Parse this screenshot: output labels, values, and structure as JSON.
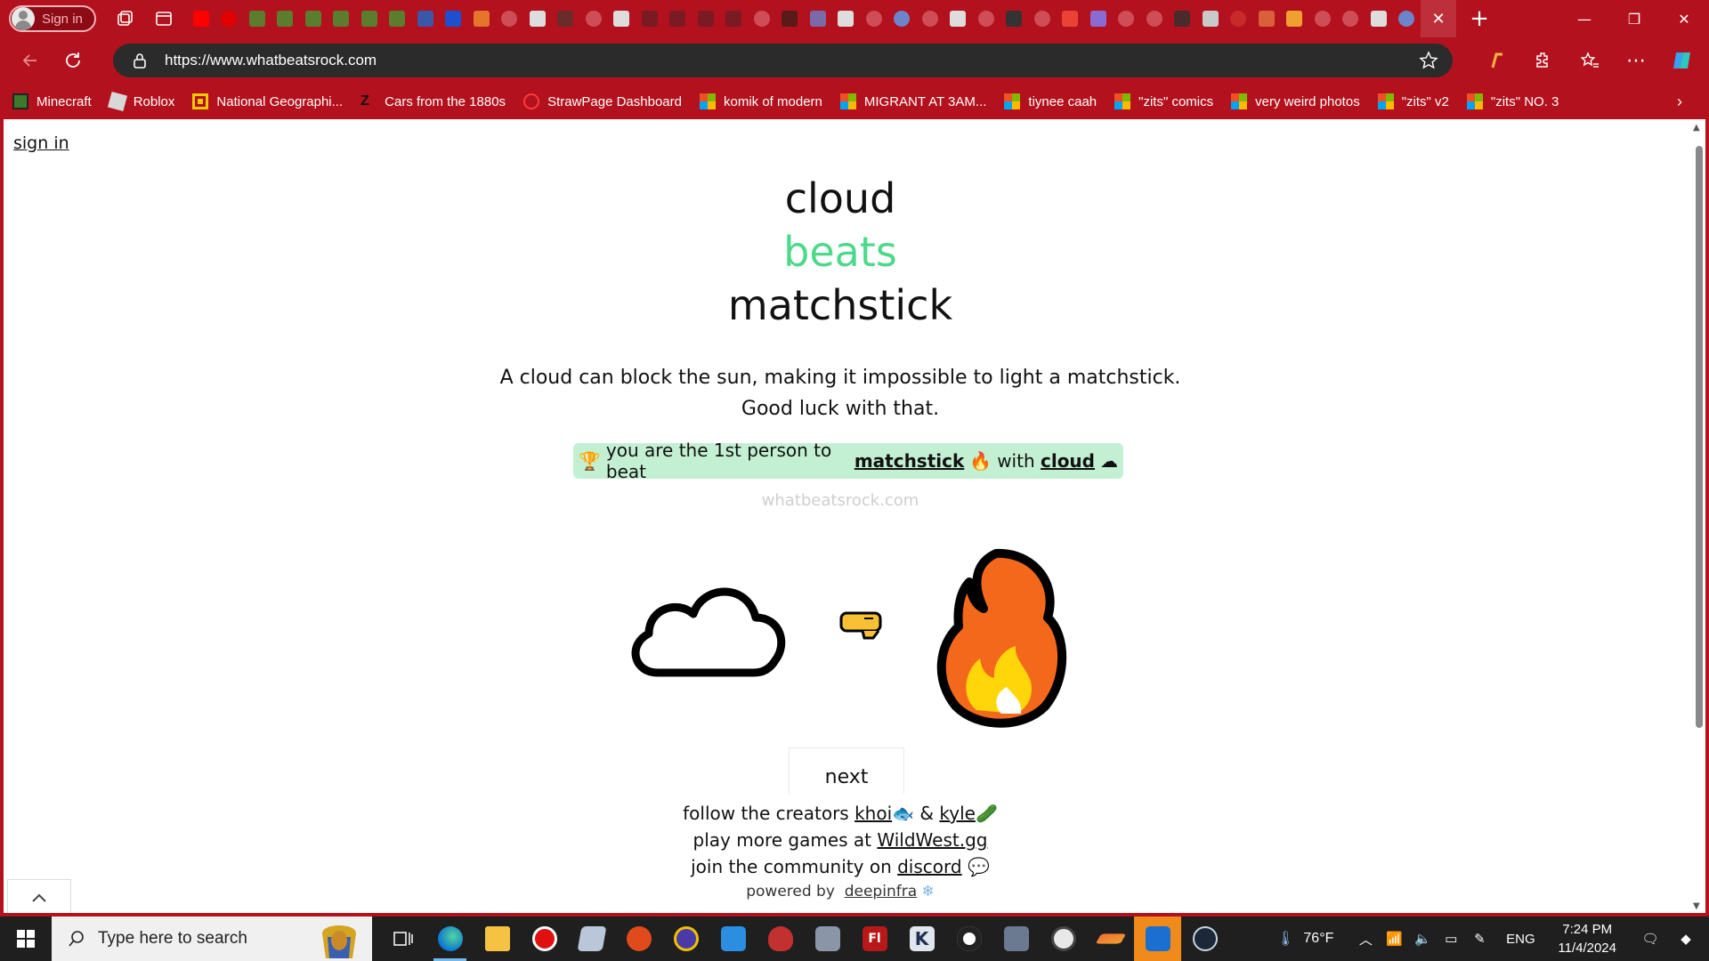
{
  "browser": {
    "profile_label": "Sign in",
    "url": "https://www.whatbeatsrock.com",
    "bookmarks": [
      {
        "label": "Minecraft",
        "icon": "minecraft-icon"
      },
      {
        "label": "Roblox",
        "icon": "roblox-icon"
      },
      {
        "label": "National Geographi...",
        "icon": "natgeo-icon"
      },
      {
        "label": "Cars from the 1880s",
        "icon": "z-icon"
      },
      {
        "label": "StrawPage Dashboard",
        "icon": "strawpage-icon"
      },
      {
        "label": "komik of modern",
        "icon": "ms-logo-icon"
      },
      {
        "label": "MIGRANT AT 3AM...",
        "icon": "ms-logo-icon"
      },
      {
        "label": "tiynee caah",
        "icon": "ms-logo-icon"
      },
      {
        "label": "\"zits\" comics",
        "icon": "ms-logo-icon"
      },
      {
        "label": "very weird photos",
        "icon": "ms-logo-icon"
      },
      {
        "label": "\"zits\" v2",
        "icon": "ms-logo-icon"
      },
      {
        "label": "\"zits\" NO. 3",
        "icon": "ms-logo-icon"
      }
    ]
  },
  "page": {
    "signin_label": "sign in",
    "word_top": "cloud",
    "word_middle": "beats",
    "word_bottom": "matchstick",
    "description": "A cloud can block the sun, making it impossible to light a matchstick. Good luck with that.",
    "badge": {
      "prefix": "you are the 1st person to beat",
      "beaten": "matchstick",
      "middle": "with",
      "winner": "cloud"
    },
    "site_name": "whatbeatsrock.com",
    "next_label": "next",
    "footer": {
      "creators_prefix": "follow the creators",
      "creator_1": "khoi",
      "and": "&",
      "creator_2": "kyle",
      "games_prefix": "play more games at",
      "games_link": "WildWest.gg",
      "community_prefix": "join the community on",
      "community_link": "discord",
      "powered_prefix": "powered by",
      "powered_link": "deepinfra"
    },
    "colors": {
      "beats_green": "#4ed98a",
      "badge_bg": "#c3f0d2",
      "fire_orange": "#f4681c",
      "fire_yellow": "#ffd60a"
    }
  },
  "taskbar": {
    "search_placeholder": "Type here to search",
    "temperature": "76°F",
    "language": "ENG",
    "time": "7:24 PM",
    "date": "11/4/2024"
  },
  "accent": "#b3111d"
}
